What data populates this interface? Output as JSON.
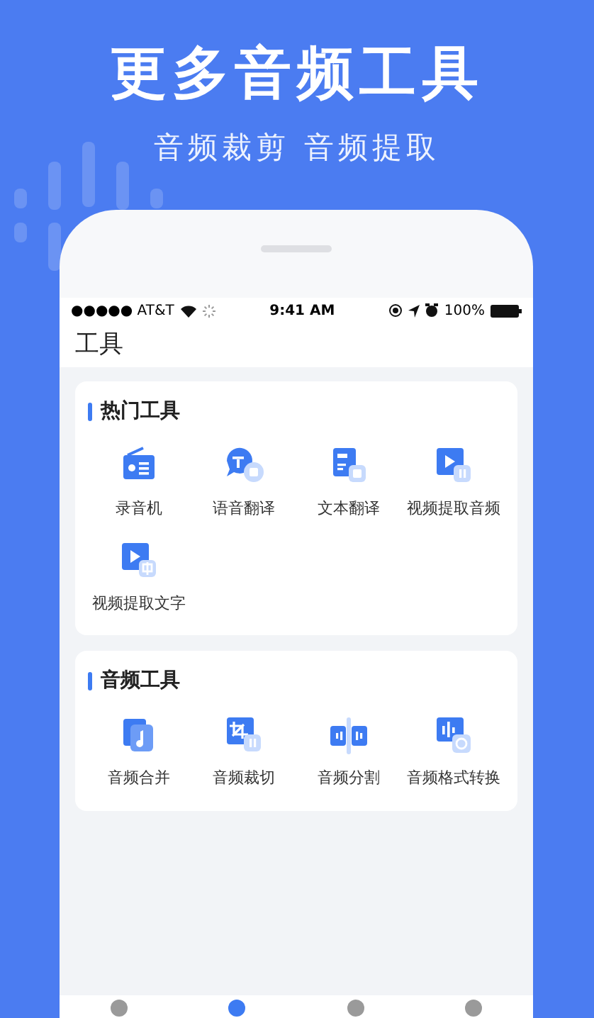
{
  "headline": "更多音频工具",
  "subheadline": "音频裁剪 音频提取",
  "status_bar": {
    "carrier": "●●●●● AT&T",
    "time": "9:41 AM",
    "battery": "100%"
  },
  "page_title": "工具",
  "sections": [
    {
      "title": "热门工具",
      "tools": [
        {
          "label": "录音机",
          "kind": "radio"
        },
        {
          "label": "语音翻译",
          "kind": "voice-translate"
        },
        {
          "label": "文本翻译",
          "kind": "text-translate"
        },
        {
          "label": "视频提取音频",
          "kind": "video-audio"
        },
        {
          "label": "视频提取文字",
          "kind": "video-text"
        }
      ]
    },
    {
      "title": "音频工具",
      "tools": [
        {
          "label": "音频合并",
          "kind": "merge"
        },
        {
          "label": "音频裁切",
          "kind": "crop"
        },
        {
          "label": "音频分割",
          "kind": "split"
        },
        {
          "label": "音频格式转换",
          "kind": "convert"
        }
      ]
    }
  ],
  "tab_bar": [
    {
      "selected": false
    },
    {
      "selected": true
    },
    {
      "selected": false
    },
    {
      "selected": false
    }
  ]
}
